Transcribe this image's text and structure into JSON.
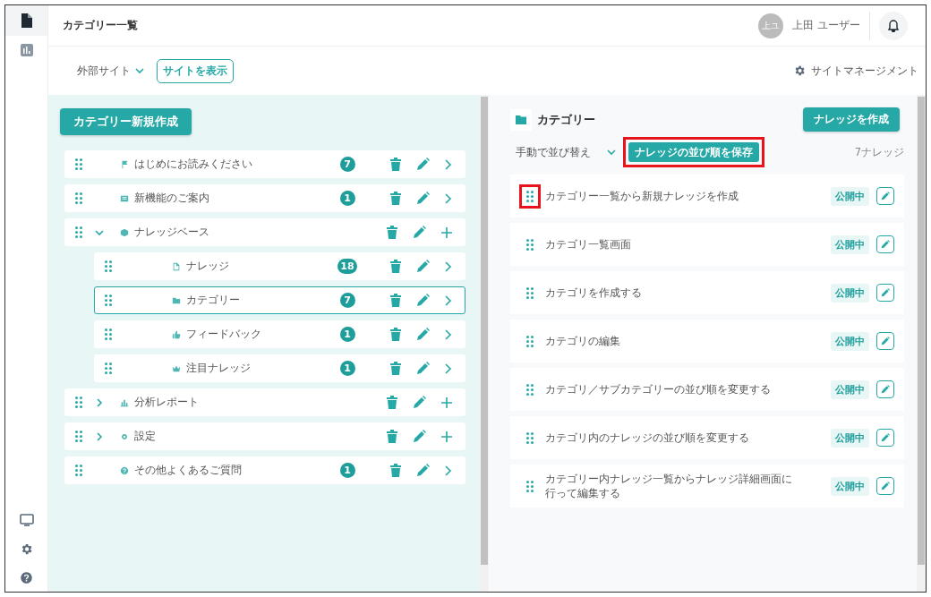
{
  "header": {
    "title": "カテゴリー一覧",
    "user": {
      "initials": "上ユ",
      "name": "上田 ユーザー"
    }
  },
  "subheader": {
    "site_select": "外部サイト",
    "view_site": "サイトを表示",
    "management": "サイトマネージメント"
  },
  "sidebar": {
    "top": [
      {
        "kind": "document",
        "selected": true
      },
      {
        "kind": "chart",
        "selected": false
      }
    ],
    "bottom": [
      {
        "kind": "monitor"
      },
      {
        "kind": "settings"
      },
      {
        "kind": "help"
      }
    ]
  },
  "tree": {
    "create_button": "カテゴリー新規作成",
    "items": [
      {
        "kind": "flag",
        "label": "はじめにお読みください",
        "count": "7",
        "expandable": false,
        "selected": false
      },
      {
        "kind": "news",
        "label": "新機能のご案内",
        "count": "1",
        "expandable": false,
        "selected": false
      },
      {
        "kind": "cube",
        "label": "ナレッジベース",
        "expandable": true,
        "expanded": true,
        "selected": false,
        "children": [
          {
            "kind": "doc",
            "label": "ナレッジ",
            "count": "18",
            "expandable": false,
            "selected": false
          },
          {
            "kind": "folder",
            "label": "カテゴリー",
            "count": "7",
            "expandable": false,
            "selected": true
          },
          {
            "kind": "thumb",
            "label": "フィードバック",
            "count": "1",
            "expandable": false,
            "selected": false
          },
          {
            "kind": "crown",
            "label": "注目ナレッジ",
            "count": "1",
            "expandable": false,
            "selected": false
          }
        ]
      },
      {
        "kind": "bars",
        "label": "分析レポート",
        "expandable": true,
        "expanded": false,
        "selected": false
      },
      {
        "kind": "gear",
        "label": "設定",
        "expandable": true,
        "expanded": false,
        "selected": false
      },
      {
        "kind": "question",
        "label": "その他よくあるご質問",
        "count": "1",
        "expandable": false,
        "selected": false
      }
    ]
  },
  "category": {
    "title": "カテゴリー",
    "create_button": "ナレッジを作成",
    "sort_select": "手動で並び替え",
    "save_order_button": "ナレッジの並び順を保存",
    "save_order_highlighted": true,
    "count": "7ナレッジ",
    "articles": [
      {
        "title": "カテゴリー一覧から新規ナレッジを作成",
        "status": "公開中",
        "handle_highlighted": true
      },
      {
        "title": "カテゴリ一覧画面",
        "status": "公開中",
        "handle_highlighted": false
      },
      {
        "title": "カテゴリを作成する",
        "status": "公開中",
        "handle_highlighted": false
      },
      {
        "title": "カテゴリの編集",
        "status": "公開中",
        "handle_highlighted": false
      },
      {
        "title": "カテゴリ／サブカテゴリーの並び順を変更する",
        "status": "公開中",
        "handle_highlighted": false
      },
      {
        "title": "カテゴリ内のナレッジの並び順を変更する",
        "status": "公開中",
        "handle_highlighted": false
      },
      {
        "title": "カテゴリー内ナレッジ一覧からナレッジ詳細画面に行って編集する",
        "status": "公開中",
        "handle_highlighted": false
      }
    ]
  }
}
